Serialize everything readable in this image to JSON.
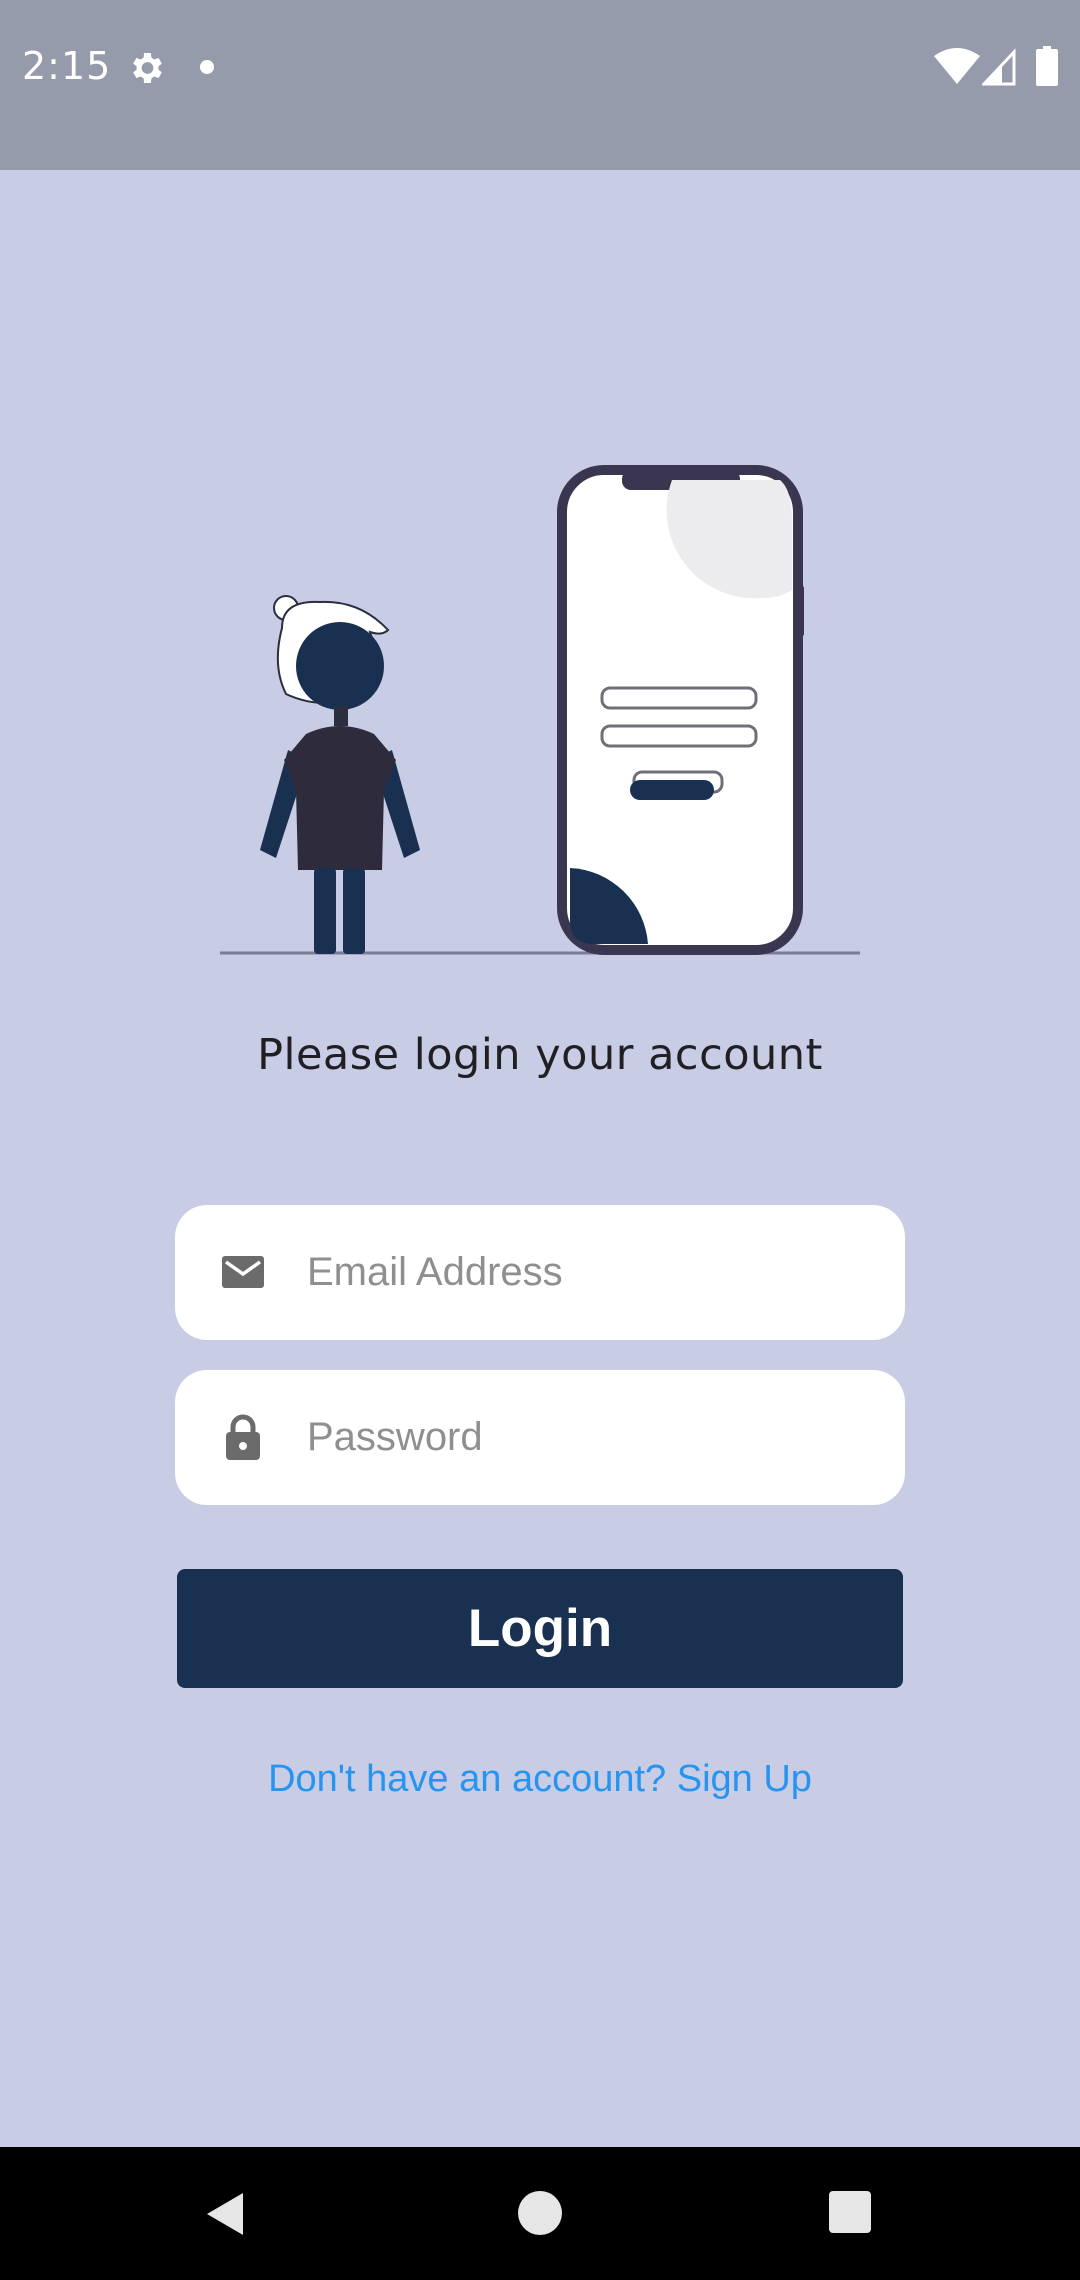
{
  "status_bar": {
    "time": "2:15",
    "icons": [
      "gear-icon",
      "notification-dot-icon",
      "wifi-icon",
      "cell-signal-icon",
      "battery-icon"
    ],
    "background_color": "#969bab"
  },
  "screen": {
    "background_color": "#c8cce5",
    "illustration": "person-standing-next-to-phone-login-illustration"
  },
  "login_form": {
    "headline": "Please login your account",
    "email": {
      "icon": "mail-icon",
      "placeholder": "Email Address",
      "value": ""
    },
    "password": {
      "icon": "lock-icon",
      "placeholder": "Password",
      "value": ""
    },
    "login_label": "Login",
    "login_color": "#1a3050",
    "signup_link": "Don't have an account? Sign Up",
    "signup_color": "#2795f0"
  },
  "nav_bar": {
    "buttons": [
      "back-icon",
      "home-icon",
      "recents-icon"
    ]
  }
}
